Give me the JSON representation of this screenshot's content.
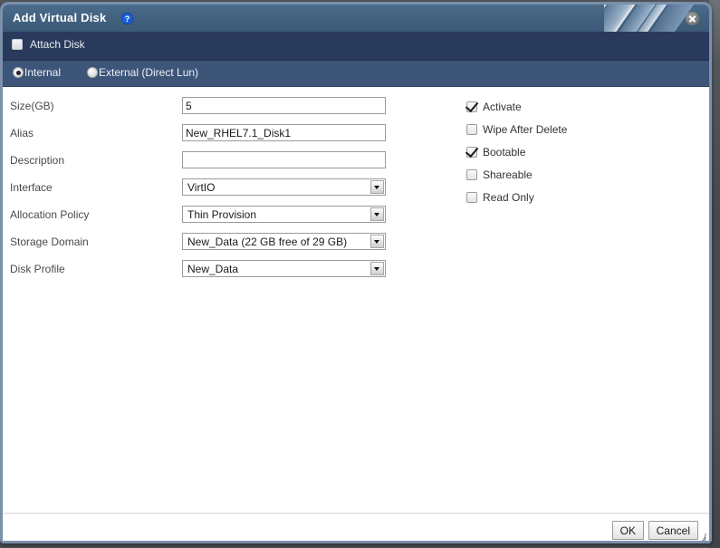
{
  "dialog": {
    "title": "Add Virtual Disk",
    "help_icon": "help-circle-icon",
    "close_icon": "close-icon"
  },
  "attach_section": {
    "label": "Attach Disk",
    "checked": false
  },
  "disk_type": {
    "options": [
      {
        "label": "Internal",
        "selected": true
      },
      {
        "label": "External (Direct Lun)",
        "selected": false
      }
    ]
  },
  "form": {
    "rows": [
      {
        "label": "Size(GB)",
        "type": "text",
        "value": "5",
        "placeholder": ""
      },
      {
        "label": "Alias",
        "type": "text",
        "value": "New_RHEL7.1_Disk1",
        "placeholder": ""
      },
      {
        "label": "Description",
        "type": "text",
        "value": "",
        "placeholder": ""
      },
      {
        "label": "Interface",
        "type": "select",
        "value": "VirtIO"
      },
      {
        "label": "Allocation Policy",
        "type": "select",
        "value": "Thin Provision"
      },
      {
        "label": "Storage Domain",
        "type": "select",
        "value": "New_Data (22 GB free of 29 GB)"
      },
      {
        "label": "Disk Profile",
        "type": "select",
        "value": "New_Data"
      }
    ]
  },
  "options": {
    "items": [
      {
        "label": "Activate",
        "checked": true
      },
      {
        "label": "Wipe After Delete",
        "checked": false
      },
      {
        "label": "Bootable",
        "checked": true
      },
      {
        "label": "Shareable",
        "checked": false
      },
      {
        "label": "Read Only",
        "checked": false
      }
    ]
  },
  "footer": {
    "ok_label": "OK",
    "cancel_label": "Cancel",
    "resize_grip": "resize-grip-icon"
  },
  "colors": {
    "titlebar": "#41617f",
    "attach_band": "#2a3a5c",
    "radio_band": "#3c5579",
    "frame_border": "#7a90ab",
    "help_blue": "#1b5fd9"
  }
}
